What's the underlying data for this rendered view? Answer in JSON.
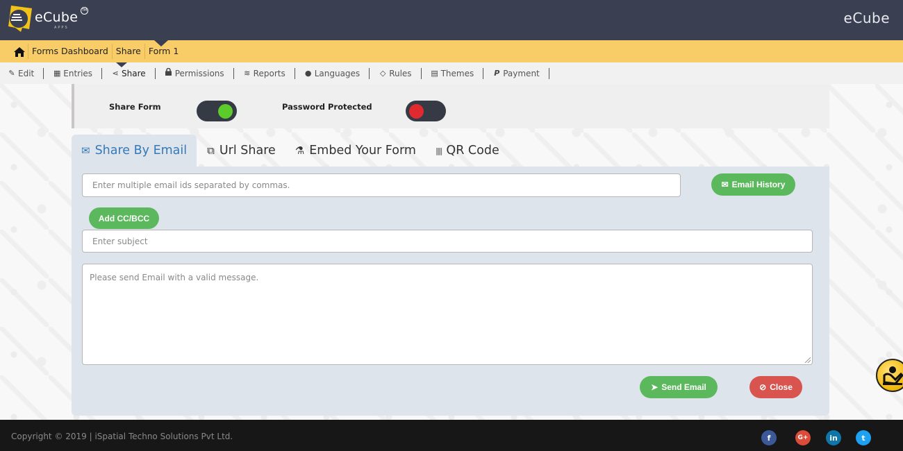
{
  "header": {
    "logo_text": "eCube",
    "logo_subtext": "APPS",
    "logo_tm": "TM",
    "brand_right": "eCube"
  },
  "breadcrumb": {
    "items": [
      "Forms Dashboard",
      "Share",
      "Form 1"
    ]
  },
  "toolnav": {
    "items": [
      {
        "label": "Edit",
        "icon": "edit-icon",
        "glyph": "✎"
      },
      {
        "label": "Entries",
        "icon": "table-icon",
        "glyph": "▦"
      },
      {
        "label": "Share",
        "icon": "share-icon",
        "glyph": "⋖",
        "active": true
      },
      {
        "label": "Permissions",
        "icon": "lock-icon",
        "glyph": "🔒"
      },
      {
        "label": "Reports",
        "icon": "database-icon",
        "glyph": "≋"
      },
      {
        "label": "Languages",
        "icon": "language-icon",
        "glyph": "●"
      },
      {
        "label": "Rules",
        "icon": "rules-icon",
        "glyph": "◇"
      },
      {
        "label": "Themes",
        "icon": "themes-icon",
        "glyph": "▤"
      },
      {
        "label": "Payment",
        "icon": "paypal-icon",
        "glyph": "P"
      }
    ]
  },
  "toggles": {
    "share_form_label": "Share Form",
    "share_form_on": true,
    "password_protected_label": "Password Protected",
    "password_protected_on": false,
    "on_color": "#5ccc2c",
    "off_color": "#e02a2f"
  },
  "tabs": [
    {
      "label": "Share By Email",
      "glyph": "✉",
      "active": true
    },
    {
      "label": "Url Share",
      "glyph": "⧉"
    },
    {
      "label": "Embed Your Form",
      "glyph": "⚗"
    },
    {
      "label": "QR Code",
      "glyph": "|||||"
    }
  ],
  "email_form": {
    "emails_placeholder": "Enter multiple email ids separated by commas.",
    "email_history_label": "Email History",
    "add_cc_bcc_label": "Add CC/BCC",
    "subject_placeholder": "Enter subject",
    "message_placeholder": "Please send Email with a valid message.",
    "send_label": "Send Email",
    "close_label": "Close"
  },
  "footer": {
    "copyright": "Copyright © 2019 | iSpatial Techno Solutions Pvt Ltd.",
    "social": [
      {
        "name": "facebook",
        "glyph": "f",
        "color": "#3b5998"
      },
      {
        "name": "google-plus",
        "glyph": "G+",
        "color": "#dd4b39"
      },
      {
        "name": "linkedin",
        "glyph": "in",
        "color": "#0e76a8"
      },
      {
        "name": "twitter",
        "glyph": "t",
        "color": "#1da1f2"
      }
    ]
  },
  "colors": {
    "header_bg": "#3a3f51",
    "breadcrumb_bg": "#f8cd68",
    "accent_blue": "#3579b8",
    "success_green": "#5cb85c",
    "danger_red": "#d9534f"
  }
}
